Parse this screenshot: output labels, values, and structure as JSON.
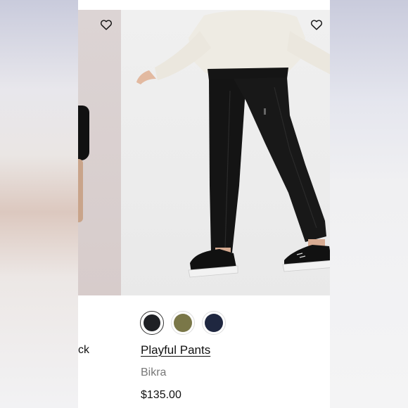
{
  "products": {
    "previous": {
      "name_partial": "ck"
    },
    "current": {
      "name": "Playful Pants",
      "brand": "Bikra",
      "price": "$135.00",
      "swatches": [
        {
          "color": "#1e2024",
          "selected": true
        },
        {
          "color": "#7a7748",
          "selected": false
        },
        {
          "color": "#1f2740",
          "selected": false
        }
      ]
    }
  },
  "icons": {
    "favorite": "heart-outline-icon"
  }
}
